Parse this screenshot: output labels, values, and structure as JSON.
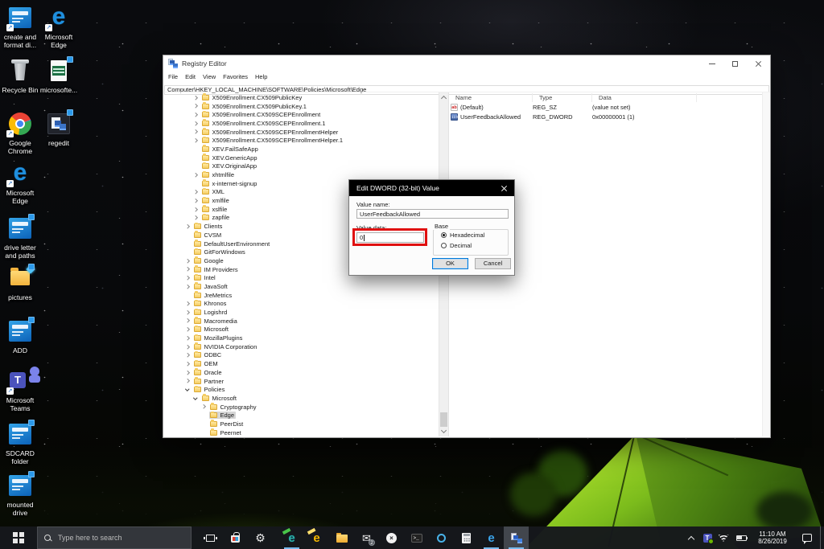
{
  "colors": {
    "accent": "#0078d7",
    "annotation_red": "#e01010",
    "selection_gray": "#d6d6d6",
    "dialog_titlebar": "#000000",
    "taskbar_bg": "#16181c"
  },
  "desktop": {
    "icons": [
      {
        "label": "create and\nformat di...",
        "icon": "win-app"
      },
      {
        "label": "Microsoft\nEdge",
        "icon": "edge"
      },
      {
        "label": "Recycle Bin",
        "icon": "recycle-bin"
      },
      {
        "label": "microsofte...",
        "icon": "excel-doc"
      },
      {
        "label": "Google\nChrome",
        "icon": "chrome"
      },
      {
        "label": "regedit",
        "icon": "regedit"
      },
      {
        "label": "Microsoft\nEdge",
        "icon": "edge"
      },
      {
        "label": "drive letter\nand paths",
        "icon": "win-app"
      },
      {
        "label": "pictures",
        "icon": "folder-pictures"
      },
      {
        "label": "ADD",
        "icon": "win-app"
      },
      {
        "label": "Microsoft\nTeams",
        "icon": "teams"
      },
      {
        "label": "SDCARD\nfolder",
        "icon": "win-app"
      },
      {
        "label": "mounted\ndrive",
        "icon": "win-app"
      }
    ]
  },
  "window": {
    "title": "Registry Editor",
    "menu": [
      "File",
      "Edit",
      "View",
      "Favorites",
      "Help"
    ],
    "address": "Computer\\HKEY_LOCAL_MACHINE\\SOFTWARE\\Policies\\Microsoft\\Edge",
    "tree": [
      {
        "label": "X509Enrollment.CX509PublicKey",
        "level": 1,
        "state": "collapsed"
      },
      {
        "label": "X509Enrollment.CX509PublicKey.1",
        "level": 1,
        "state": "collapsed"
      },
      {
        "label": "X509Enrollment.CX509SCEPEnrollment",
        "level": 1,
        "state": "collapsed"
      },
      {
        "label": "X509Enrollment.CX509SCEPEnrollment.1",
        "level": 1,
        "state": "collapsed"
      },
      {
        "label": "X509Enrollment.CX509SCEPEnrollmentHelper",
        "level": 1,
        "state": "collapsed"
      },
      {
        "label": "X509Enrollment.CX509SCEPEnrollmentHelper.1",
        "level": 1,
        "state": "collapsed"
      },
      {
        "label": "XEV.FailSafeApp",
        "level": 1,
        "state": "none"
      },
      {
        "label": "XEV.GenericApp",
        "level": 1,
        "state": "none"
      },
      {
        "label": "XEV.OriginalApp",
        "level": 1,
        "state": "none"
      },
      {
        "label": "xhtmlfile",
        "level": 1,
        "state": "collapsed"
      },
      {
        "label": "x-internet-signup",
        "level": 1,
        "state": "none"
      },
      {
        "label": "XML",
        "level": 1,
        "state": "collapsed"
      },
      {
        "label": "xmlfile",
        "level": 1,
        "state": "collapsed"
      },
      {
        "label": "xslfile",
        "level": 1,
        "state": "collapsed"
      },
      {
        "label": "zapfile",
        "level": 1,
        "state": "collapsed"
      },
      {
        "label": "Clients",
        "level": 0,
        "state": "collapsed"
      },
      {
        "label": "CVSM",
        "level": 0,
        "state": "none"
      },
      {
        "label": "DefaultUserEnvironment",
        "level": 0,
        "state": "none"
      },
      {
        "label": "GitForWindows",
        "level": 0,
        "state": "none"
      },
      {
        "label": "Google",
        "level": 0,
        "state": "collapsed"
      },
      {
        "label": "IM Providers",
        "level": 0,
        "state": "collapsed"
      },
      {
        "label": "Intel",
        "level": 0,
        "state": "collapsed"
      },
      {
        "label": "JavaSoft",
        "level": 0,
        "state": "collapsed"
      },
      {
        "label": "JreMetrics",
        "level": 0,
        "state": "none"
      },
      {
        "label": "Khronos",
        "level": 0,
        "state": "collapsed"
      },
      {
        "label": "Logishrd",
        "level": 0,
        "state": "collapsed"
      },
      {
        "label": "Macromedia",
        "level": 0,
        "state": "collapsed"
      },
      {
        "label": "Microsoft",
        "level": 0,
        "state": "collapsed"
      },
      {
        "label": "MozillaPlugins",
        "level": 0,
        "state": "collapsed"
      },
      {
        "label": "NVIDIA Corporation",
        "level": 0,
        "state": "collapsed"
      },
      {
        "label": "ODBC",
        "level": 0,
        "state": "collapsed"
      },
      {
        "label": "OEM",
        "level": 0,
        "state": "collapsed"
      },
      {
        "label": "Oracle",
        "level": 0,
        "state": "collapsed"
      },
      {
        "label": "Partner",
        "level": 0,
        "state": "collapsed"
      },
      {
        "label": "Policies",
        "level": 0,
        "state": "expanded"
      },
      {
        "label": "Microsoft",
        "level": 1,
        "state": "expanded"
      },
      {
        "label": "Cryptography",
        "level": 2,
        "state": "collapsed"
      },
      {
        "label": "Edge",
        "level": 2,
        "state": "none",
        "selected": true
      },
      {
        "label": "PeerDist",
        "level": 2,
        "state": "none"
      },
      {
        "label": "Peernet",
        "level": 2,
        "state": "none"
      }
    ],
    "list": {
      "columns": [
        "Name",
        "Type",
        "Data"
      ],
      "rows": [
        {
          "name": "(Default)",
          "type": "REG_SZ",
          "data": "(value not set)",
          "icon": "string-value-icon",
          "glyph": "ab"
        },
        {
          "name": "UserFeedbackAllowed",
          "type": "REG_DWORD",
          "data": "0x00000001 (1)",
          "icon": "dword-value-icon",
          "glyph": "110"
        }
      ]
    }
  },
  "dialog": {
    "title": "Edit DWORD (32-bit) Value",
    "value_name_label": "Value name:",
    "value_name": "UserFeedbackAllowed",
    "value_data_label": "Value data:",
    "value_data": "0",
    "base_label": "Base",
    "options": [
      {
        "label": "Hexadecimal",
        "selected": true
      },
      {
        "label": "Decimal",
        "selected": false
      }
    ],
    "ok_label": "OK",
    "cancel_label": "Cancel"
  },
  "taskbar": {
    "search_placeholder": "Type here to search",
    "system_buttons": [
      "task-view",
      "store",
      "settings"
    ],
    "apps": [
      {
        "name": "edge-dev",
        "running": true
      },
      {
        "name": "edge-canary",
        "running": false
      },
      {
        "name": "file-explorer",
        "running": false
      },
      {
        "name": "mail",
        "running": false,
        "badge": "2"
      },
      {
        "name": "xbox",
        "running": false
      },
      {
        "name": "command-prompt",
        "running": false
      },
      {
        "name": "cortana",
        "running": false
      },
      {
        "name": "calculator",
        "running": false
      },
      {
        "name": "edge",
        "running": true
      },
      {
        "name": "registry-editor",
        "running": true,
        "active": true
      }
    ],
    "clock": {
      "time": "11:10 AM",
      "date": "8/26/2019"
    }
  }
}
